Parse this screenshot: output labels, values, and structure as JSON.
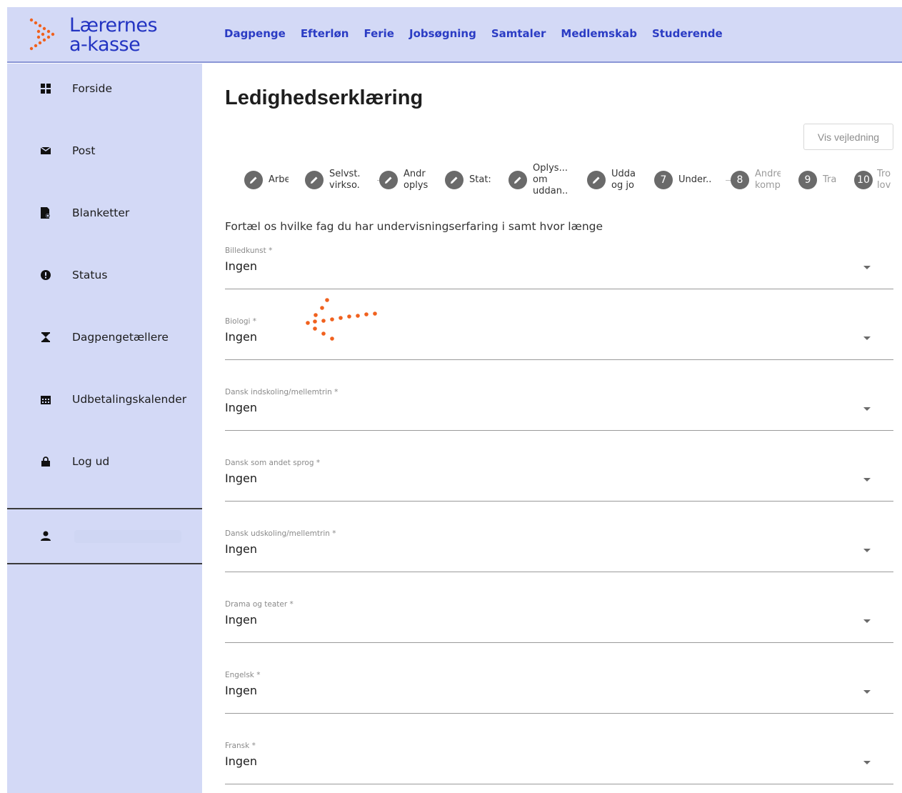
{
  "brand": {
    "line1": "Lærernes",
    "line2": "a-kasse",
    "accent": "#f0611e",
    "primary": "#2b3cc4"
  },
  "topnav": [
    "Dagpenge",
    "Efterløn",
    "Ferie",
    "Jobsøgning",
    "Samtaler",
    "Medlemskab",
    "Studerende"
  ],
  "sidebar": {
    "items": [
      {
        "label": "Forside",
        "icon": "grid-icon"
      },
      {
        "label": "Post",
        "icon": "envelope-icon"
      },
      {
        "label": "Blanketter",
        "icon": "document-icon"
      },
      {
        "label": "Status",
        "icon": "alert-icon"
      },
      {
        "label": "Dagpengetællere",
        "icon": "hourglass-icon"
      },
      {
        "label": "Udbetalingskalender",
        "icon": "calendar-icon"
      },
      {
        "label": "Log ud",
        "icon": "lock-icon"
      }
    ],
    "user_icon": "user-icon"
  },
  "main": {
    "title": "Ledighedserklæring",
    "guide_button": "Vis vejledning",
    "steps": [
      {
        "marker": "",
        "label": "Arbe",
        "state": "done"
      },
      {
        "marker": "",
        "label": "Selvst.\nvirkso.",
        "state": "done"
      },
      {
        "marker": "",
        "label": "Andr\noplys",
        "state": "done"
      },
      {
        "marker": "",
        "label": "Stat:",
        "state": "done"
      },
      {
        "marker": "",
        "label": "Oplys...\nom\nuddan..",
        "state": "done"
      },
      {
        "marker": "",
        "label": "Udda\nog jo",
        "state": "done"
      },
      {
        "marker": "7",
        "label": "Under..",
        "state": "current"
      },
      {
        "marker": "8",
        "label": "Andre\nkomp",
        "state": "upcoming"
      },
      {
        "marker": "9",
        "label": "Tra",
        "state": "upcoming"
      },
      {
        "marker": "10",
        "label": "Tro\nlov",
        "state": "upcoming"
      }
    ],
    "intro": "Fortæl os hvilke fag du har undervisningserfaring i samt hvor længe",
    "fields": [
      {
        "label": "Billedkunst *",
        "value": "Ingen"
      },
      {
        "label": "Biologi *",
        "value": "Ingen"
      },
      {
        "label": "Dansk indskoling/mellemtrin *",
        "value": "Ingen"
      },
      {
        "label": "Dansk som andet sprog *",
        "value": "Ingen"
      },
      {
        "label": "Dansk udskoling/mellemtrin *",
        "value": "Ingen"
      },
      {
        "label": "Drama og teater *",
        "value": "Ingen"
      },
      {
        "label": "Engelsk *",
        "value": "Ingen"
      },
      {
        "label": "Fransk *",
        "value": "Ingen"
      }
    ]
  }
}
